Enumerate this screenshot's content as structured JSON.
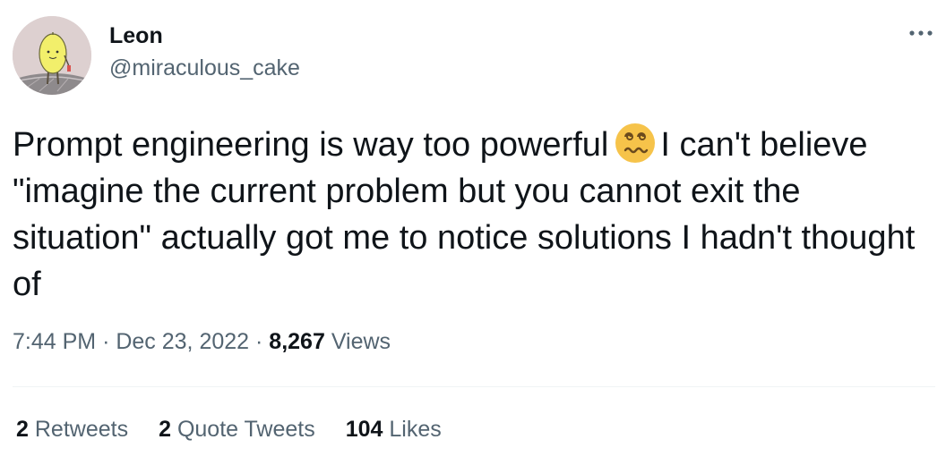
{
  "author": {
    "name": "Leon",
    "handle": "@miraculous_cake"
  },
  "tweet": {
    "text_before_emoji": "Prompt engineering is way too powerful",
    "emoji": "face-with-spiral-eyes",
    "text_after_emoji": "I can't believe \"imagine the current problem but you cannot exit the situation\" actually got me to notice solutions I hadn't thought of"
  },
  "meta": {
    "time": "7:44 PM",
    "separator": "·",
    "date": "Dec 23, 2022",
    "views_count": "8,267",
    "views_label": "Views"
  },
  "stats": {
    "retweets_count": "2",
    "retweets_label": "Retweets",
    "quote_tweets_count": "2",
    "quote_tweets_label": "Quote Tweets",
    "likes_count": "104",
    "likes_label": "Likes"
  },
  "colors": {
    "text_primary": "#0f1419",
    "text_secondary": "#536471",
    "divider": "#eff3f4",
    "emoji_face": "#f6c34a"
  }
}
